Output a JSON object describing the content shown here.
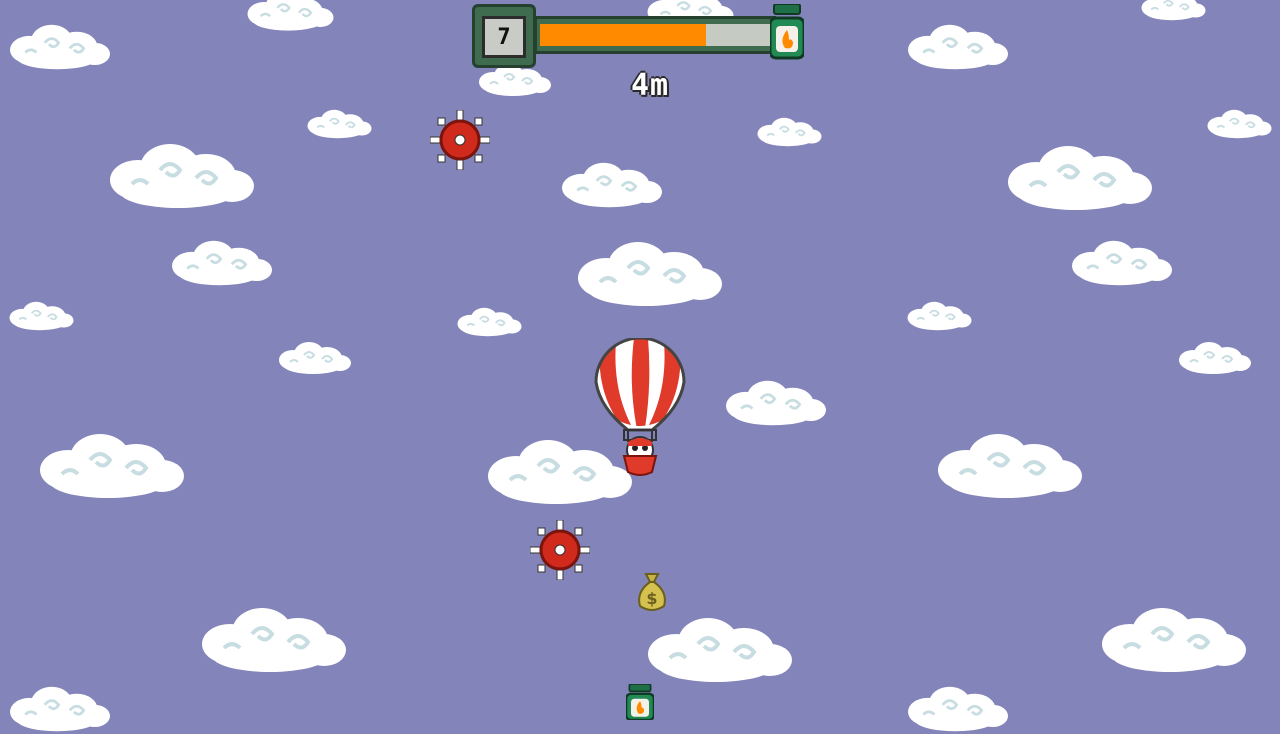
{
  "hud": {
    "level": "7",
    "fuel_fraction": 0.72,
    "fuel_fill_color": "#ff8a00",
    "fuel_icon": "fuel-canister-icon",
    "distance": "4m"
  },
  "sky_color": "#8384b9",
  "objects": {
    "player": "hot-air-balloon",
    "balloon_colors": [
      "#e03a2a",
      "#ffffff"
    ],
    "hazards": [
      "spiked-mine",
      "spiked-mine"
    ],
    "pickups": [
      "money-bag",
      "fuel-canister"
    ],
    "money_bag_symbol": "$"
  }
}
